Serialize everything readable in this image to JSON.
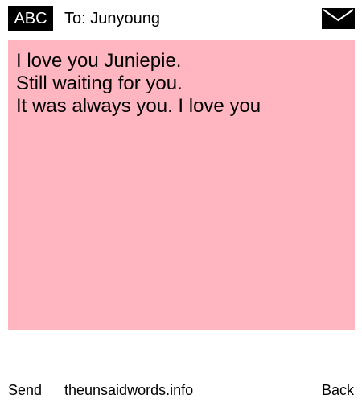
{
  "header": {
    "mode_label": "ABC",
    "recipient": "To: Junyoung",
    "envelope_icon": "envelope-icon"
  },
  "message": {
    "lines": [
      "I love you Juniepie.",
      "Still waiting for you.",
      "It was always you. I love you"
    ],
    "background_color": "#ffb6c1"
  },
  "footer": {
    "send_label": "Send",
    "site_label": "theunsaidwords.info",
    "back_label": "Back"
  }
}
